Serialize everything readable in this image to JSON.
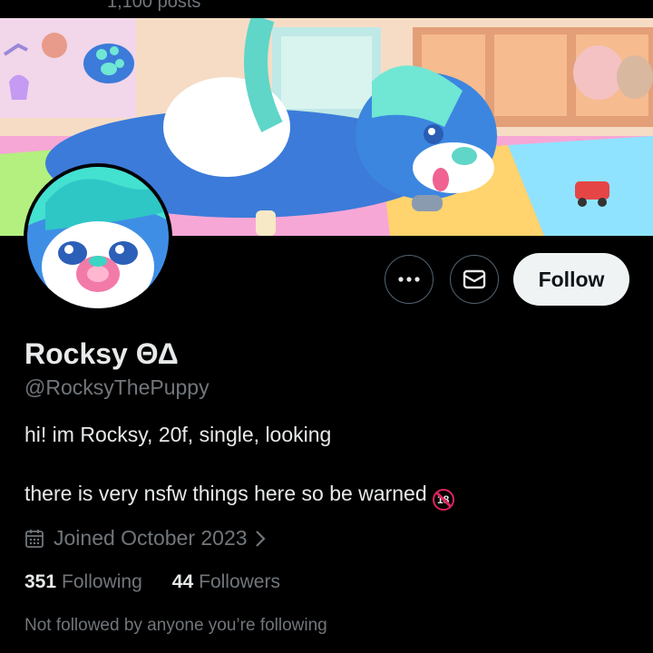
{
  "header": {
    "post_count": "1,100 posts"
  },
  "actions": {
    "more_icon": "more-horizontal-icon",
    "message_icon": "envelope-icon",
    "follow_label": "Follow"
  },
  "profile": {
    "display_name": "Rocksy ΘΔ",
    "handle": "@RocksyThePuppy",
    "bio_line1": "hi! im Rocksy, 20f, single, looking",
    "bio_line2": "there is very nsfw things here so be warned",
    "bio_badge": "18",
    "joined": "Joined October 2023",
    "following_count": "351",
    "following_label": "Following",
    "followers_count": "44",
    "followers_label": "Followers",
    "social_context": "Not followed by anyone you’re following"
  },
  "colors": {
    "background": "#000000",
    "primary_text": "#e7e9ea",
    "secondary_text": "#71767b",
    "follow_button": "#eff3f4",
    "warning_red": "#e0245e"
  }
}
